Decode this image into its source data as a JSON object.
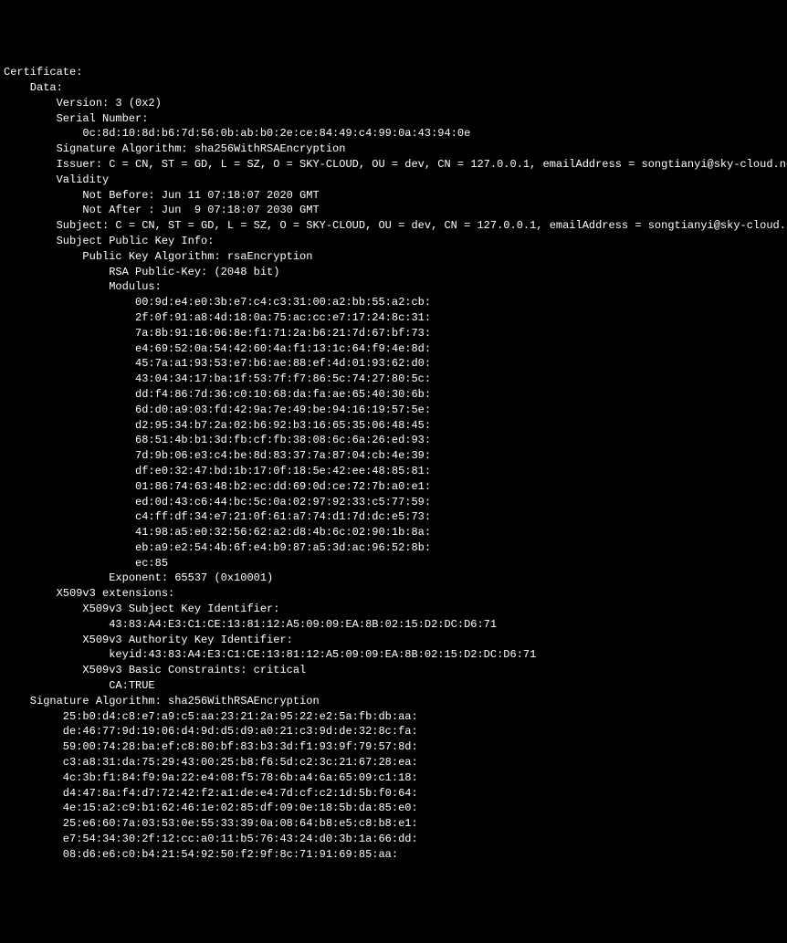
{
  "lines": [
    {
      "indent": 0,
      "text": "Certificate:"
    },
    {
      "indent": 4,
      "text": "Data:"
    },
    {
      "indent": 8,
      "text": "Version: 3 (0x2)"
    },
    {
      "indent": 8,
      "text": "Serial Number:"
    },
    {
      "indent": 12,
      "text": "0c:8d:10:8d:b6:7d:56:0b:ab:b0:2e:ce:84:49:c4:99:0a:43:94:0e"
    },
    {
      "indent": 8,
      "text": "Signature Algorithm: sha256WithRSAEncryption"
    },
    {
      "indent": 8,
      "text": "Issuer: C = CN, ST = GD, L = SZ, O = SKY-CLOUD, OU = dev, CN = 127.0.0.1, emailAddress = songtianyi@sky-cloud.net"
    },
    {
      "indent": 8,
      "text": "Validity"
    },
    {
      "indent": 12,
      "text": "Not Before: Jun 11 07:18:07 2020 GMT"
    },
    {
      "indent": 12,
      "text": "Not After : Jun  9 07:18:07 2030 GMT"
    },
    {
      "indent": 8,
      "text": "Subject: C = CN, ST = GD, L = SZ, O = SKY-CLOUD, OU = dev, CN = 127.0.0.1, emailAddress = songtianyi@sky-cloud.net"
    },
    {
      "indent": 8,
      "text": "Subject Public Key Info:"
    },
    {
      "indent": 12,
      "text": "Public Key Algorithm: rsaEncryption"
    },
    {
      "indent": 16,
      "text": "RSA Public-Key: (2048 bit)"
    },
    {
      "indent": 16,
      "text": "Modulus:"
    },
    {
      "indent": 20,
      "text": "00:9d:e4:e0:3b:e7:c4:c3:31:00:a2:bb:55:a2:cb:"
    },
    {
      "indent": 20,
      "text": "2f:0f:91:a8:4d:18:0a:75:ac:cc:e7:17:24:8c:31:"
    },
    {
      "indent": 20,
      "text": "7a:8b:91:16:06:8e:f1:71:2a:b6:21:7d:67:bf:73:"
    },
    {
      "indent": 20,
      "text": "e4:69:52:0a:54:42:60:4a:f1:13:1c:64:f9:4e:8d:"
    },
    {
      "indent": 20,
      "text": "45:7a:a1:93:53:e7:b6:ae:88:ef:4d:01:93:62:d0:"
    },
    {
      "indent": 20,
      "text": "43:04:34:17:ba:1f:53:7f:f7:86:5c:74:27:80:5c:"
    },
    {
      "indent": 20,
      "text": "dd:f4:86:7d:36:c0:10:68:da:fa:ae:65:40:30:6b:"
    },
    {
      "indent": 20,
      "text": "6d:d0:a9:03:fd:42:9a:7e:49:be:94:16:19:57:5e:"
    },
    {
      "indent": 20,
      "text": "d2:95:34:b7:2a:02:b6:92:b3:16:65:35:06:48:45:"
    },
    {
      "indent": 20,
      "text": "68:51:4b:b1:3d:fb:cf:fb:38:08:6c:6a:26:ed:93:"
    },
    {
      "indent": 20,
      "text": "7d:9b:06:e3:c4:be:8d:83:37:7a:87:04:cb:4e:39:"
    },
    {
      "indent": 20,
      "text": "df:e0:32:47:bd:1b:17:0f:18:5e:42:ee:48:85:81:"
    },
    {
      "indent": 20,
      "text": "01:86:74:63:48:b2:ec:dd:69:0d:ce:72:7b:a0:e1:"
    },
    {
      "indent": 20,
      "text": "ed:0d:43:c6:44:bc:5c:0a:02:97:92:33:c5:77:59:"
    },
    {
      "indent": 20,
      "text": "c4:ff:df:34:e7:21:0f:61:a7:74:d1:7d:dc:e5:73:"
    },
    {
      "indent": 20,
      "text": "41:98:a5:e0:32:56:62:a2:d8:4b:6c:02:90:1b:8a:"
    },
    {
      "indent": 20,
      "text": "eb:a9:e2:54:4b:6f:e4:b9:87:a5:3d:ac:96:52:8b:"
    },
    {
      "indent": 20,
      "text": "ec:85"
    },
    {
      "indent": 16,
      "text": "Exponent: 65537 (0x10001)"
    },
    {
      "indent": 8,
      "text": "X509v3 extensions:"
    },
    {
      "indent": 12,
      "text": "X509v3 Subject Key Identifier:"
    },
    {
      "indent": 16,
      "text": "43:83:A4:E3:C1:CE:13:81:12:A5:09:09:EA:8B:02:15:D2:DC:D6:71"
    },
    {
      "indent": 12,
      "text": "X509v3 Authority Key Identifier:"
    },
    {
      "indent": 16,
      "text": "keyid:43:83:A4:E3:C1:CE:13:81:12:A5:09:09:EA:8B:02:15:D2:DC:D6:71"
    },
    {
      "indent": 0,
      "text": ""
    },
    {
      "indent": 12,
      "text": "X509v3 Basic Constraints: critical"
    },
    {
      "indent": 16,
      "text": "CA:TRUE"
    },
    {
      "indent": 4,
      "text": "Signature Algorithm: sha256WithRSAEncryption"
    },
    {
      "indent": 9,
      "text": "25:b0:d4:c8:e7:a9:c5:aa:23:21:2a:95:22:e2:5a:fb:db:aa:"
    },
    {
      "indent": 9,
      "text": "de:46:77:9d:19:06:d4:9d:d5:d9:a0:21:c3:9d:de:32:8c:fa:"
    },
    {
      "indent": 9,
      "text": "59:00:74:28:ba:ef:c8:80:bf:83:b3:3d:f1:93:9f:79:57:8d:"
    },
    {
      "indent": 9,
      "text": "c3:a8:31:da:75:29:43:00:25:b8:f6:5d:c2:3c:21:67:28:ea:"
    },
    {
      "indent": 9,
      "text": "4c:3b:f1:84:f9:9a:22:e4:08:f5:78:6b:a4:6a:65:09:c1:18:"
    },
    {
      "indent": 9,
      "text": "d4:47:8a:f4:d7:72:42:f2:a1:de:e4:7d:cf:c2:1d:5b:f0:64:"
    },
    {
      "indent": 9,
      "text": "4e:15:a2:c9:b1:62:46:1e:02:85:df:09:0e:18:5b:da:85:e0:"
    },
    {
      "indent": 9,
      "text": "25:e6:60:7a:03:53:0e:55:33:39:0a:08:64:b8:e5:c8:b8:e1:"
    },
    {
      "indent": 9,
      "text": "e7:54:34:30:2f:12:cc:a0:11:b5:76:43:24:d0:3b:1a:66:dd:"
    },
    {
      "indent": 9,
      "text": "08:d6:e6:c0:b4:21:54:92:50:f2:9f:8c:71:91:69:85:aa:"
    }
  ]
}
